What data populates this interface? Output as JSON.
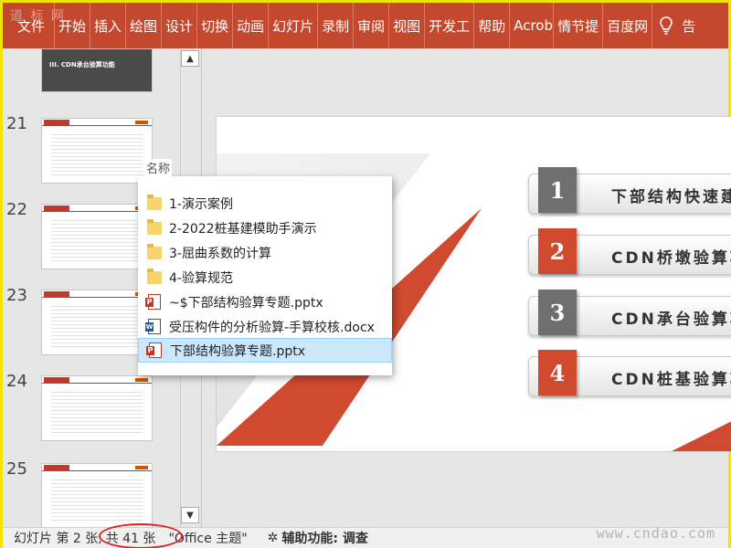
{
  "ribbon": {
    "tabs": [
      "文件",
      "开始",
      "插入",
      "绘图",
      "设计",
      "切换",
      "动画",
      "幻灯片",
      "录制",
      "审阅",
      "视图",
      "开发工",
      "帮助",
      "Acrob",
      "情节提",
      "百度网"
    ],
    "tell_me_icon": "lightbulb-icon",
    "last_tab": "告"
  },
  "watermarks": {
    "top_left": "道 标 网",
    "bottom_right": "www.cndao.com"
  },
  "thumbnails": {
    "top_title": "III. CDN承台验算功能",
    "numbers": [
      "21",
      "22",
      "23",
      "24",
      "25"
    ]
  },
  "slide": {
    "items": [
      {
        "num": "1",
        "text": "下部结构快速建模",
        "color": "gray"
      },
      {
        "num": "2",
        "text": "CDN桥墩验算功",
        "color": "red"
      },
      {
        "num": "3",
        "text": "CDN承台验算功",
        "color": "gray"
      },
      {
        "num": "4",
        "text": "CDN桩基验算功",
        "color": "red"
      }
    ]
  },
  "popup": {
    "header": "名称",
    "files": [
      {
        "name": "1-演示案例",
        "type": "folder"
      },
      {
        "name": "2-2022桩基建模助手演示",
        "type": "folder"
      },
      {
        "name": "3-屈曲系数的计算",
        "type": "folder"
      },
      {
        "name": "4-验算规范",
        "type": "folder"
      },
      {
        "name": "~$下部结构验算专题.pptx",
        "type": "pptx"
      },
      {
        "name": "受压构件的分析验算-手算校核.docx",
        "type": "docx"
      },
      {
        "name": "下部结构验算专题.pptx",
        "type": "pptx",
        "selected": true
      }
    ]
  },
  "status": {
    "slide": "幻灯片 第 2 张,",
    "total": "共 41 张",
    "theme": "\"Office 主题\"",
    "accessibility": "辅助功能: 调查"
  },
  "colors": {
    "accent": "#c4482e",
    "badge_red": "#cf4a2e",
    "badge_gray": "#6f6f6f",
    "selection": "#cce8ff",
    "annotation_ring": "#e02020"
  }
}
